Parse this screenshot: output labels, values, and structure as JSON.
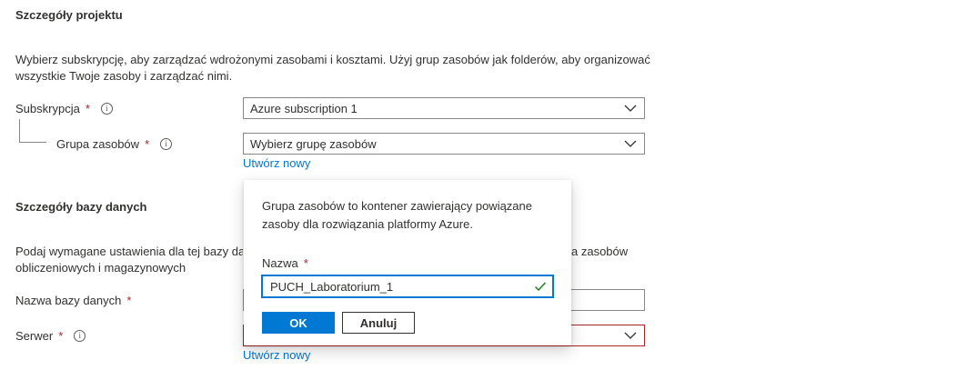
{
  "project": {
    "title": "Szczegóły projektu",
    "description_line1": "Wybierz subskrypcję, aby zarządzać wdrożonymi zasobami i kosztami. Użyj grup zasobów jak folderów, aby organizować",
    "description_line2": "wszystkie Twoje zasoby i zarządzać nimi.",
    "subscription_label": "Subskrypcja",
    "subscription_value": "Azure subscription 1",
    "resource_group_label": "Grupa zasobów",
    "resource_group_placeholder": "Wybierz grupę zasobów",
    "create_new_link": "Utwórz nowy"
  },
  "database": {
    "title": "Szczegóły bazy danych",
    "description_line1_left": "Podaj wymagane ustawienia dla tej bazy da",
    "description_line1_right": "a zasobów",
    "description_line2": "obliczeniowych i magazynowych",
    "db_name_label": "Nazwa bazy danych",
    "server_label": "Serwer",
    "create_new_link": "Utwórz nowy"
  },
  "required_marker": "*",
  "info_glyph": "i",
  "popup": {
    "description_line1": "Grupa zasobów to kontener zawierający powiązane",
    "description_line2": "zasoby dla rozwiązania platformy Azure.",
    "name_label": "Nazwa",
    "name_value": "PUCH_Laboratorium_1",
    "ok_button": "OK",
    "cancel_button": "Anuluj"
  },
  "colors": {
    "accent": "#0078d4",
    "required": "#a4262c",
    "valid": "#107c10"
  }
}
